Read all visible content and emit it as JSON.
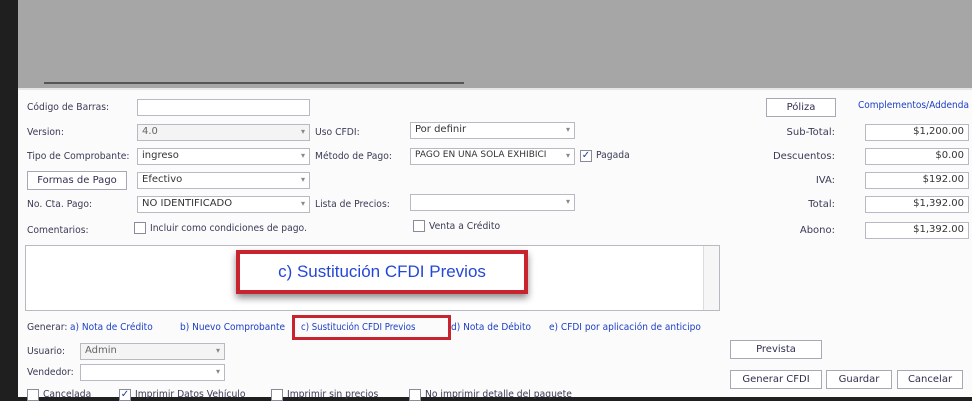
{
  "form": {
    "barcode_label": "Código de Barras:",
    "barcode_value": "",
    "version_label": "Version:",
    "version_value": "4.0",
    "uso_cfdi_label": "Uso CFDI:",
    "uso_cfdi_value": "Por definir",
    "tipo_label": "Tipo de Comprobante:",
    "tipo_value": "ingreso",
    "metodo_label": "Método de Pago:",
    "metodo_value": "PAGO EN UNA SOLA EXHIBICI",
    "pagada_label": "Pagada",
    "formas_button": "Formas de Pago",
    "formas_value": "Efectivo",
    "cuenta_label": "No. Cta. Pago:",
    "cuenta_value": "NO IDENTIFICADO",
    "lista_label": "Lista de Precios:",
    "lista_value": "",
    "comentarios_label": "Comentarios:",
    "incluir_label": "Incluir como condiciones de pago.",
    "credito_label": "Venta a Crédito"
  },
  "totals": {
    "poliza_button": "Póliza",
    "complementos_link": "Complementos/Addenda",
    "subtotal_label": "Sub-Total:",
    "subtotal_value": "$1,200.00",
    "descuentos_label": "Descuentos:",
    "descuentos_value": "$0.00",
    "iva_label": "IVA:",
    "iva_value": "$192.00",
    "total_label": "Total:",
    "total_value": "$1,392.00",
    "abono_label": "Abono:",
    "abono_value": "$1,392.00"
  },
  "callout": {
    "text": "c) Sustitución CFDI Previos"
  },
  "generar": {
    "label": "Generar:",
    "nota_credito": "a) Nota de Crédito",
    "nuevo_comprobante": "b) Nuevo Comprobante",
    "sustitucion": "c) Sustitución CFDI Previos",
    "nota_debito": "d) Nota de Débito",
    "cfdi_anticipo": "e) CFDI por aplicación de anticipo"
  },
  "bottom": {
    "usuario_label": "Usuario:",
    "usuario_value": "Admin",
    "vendedor_label": "Vendedor:",
    "vendedor_value": "",
    "prevista_button": "Prevista",
    "generar_cfdi_button": "Generar CFDI",
    "guardar_button": "Guardar",
    "cancelar_button": "Cancelar",
    "cancelada_label": "Cancelada",
    "imprimir_vehiculo_label": "Imprimir Datos Vehículo",
    "imprimir_sin_precios_label": "Imprimir sin precios",
    "no_imprimir_label": "No imprimir detalle del paquete"
  },
  "colors": {
    "highlight": "#c8242f",
    "link": "#1c3ec5",
    "grid_background": "#a6a6a6"
  }
}
